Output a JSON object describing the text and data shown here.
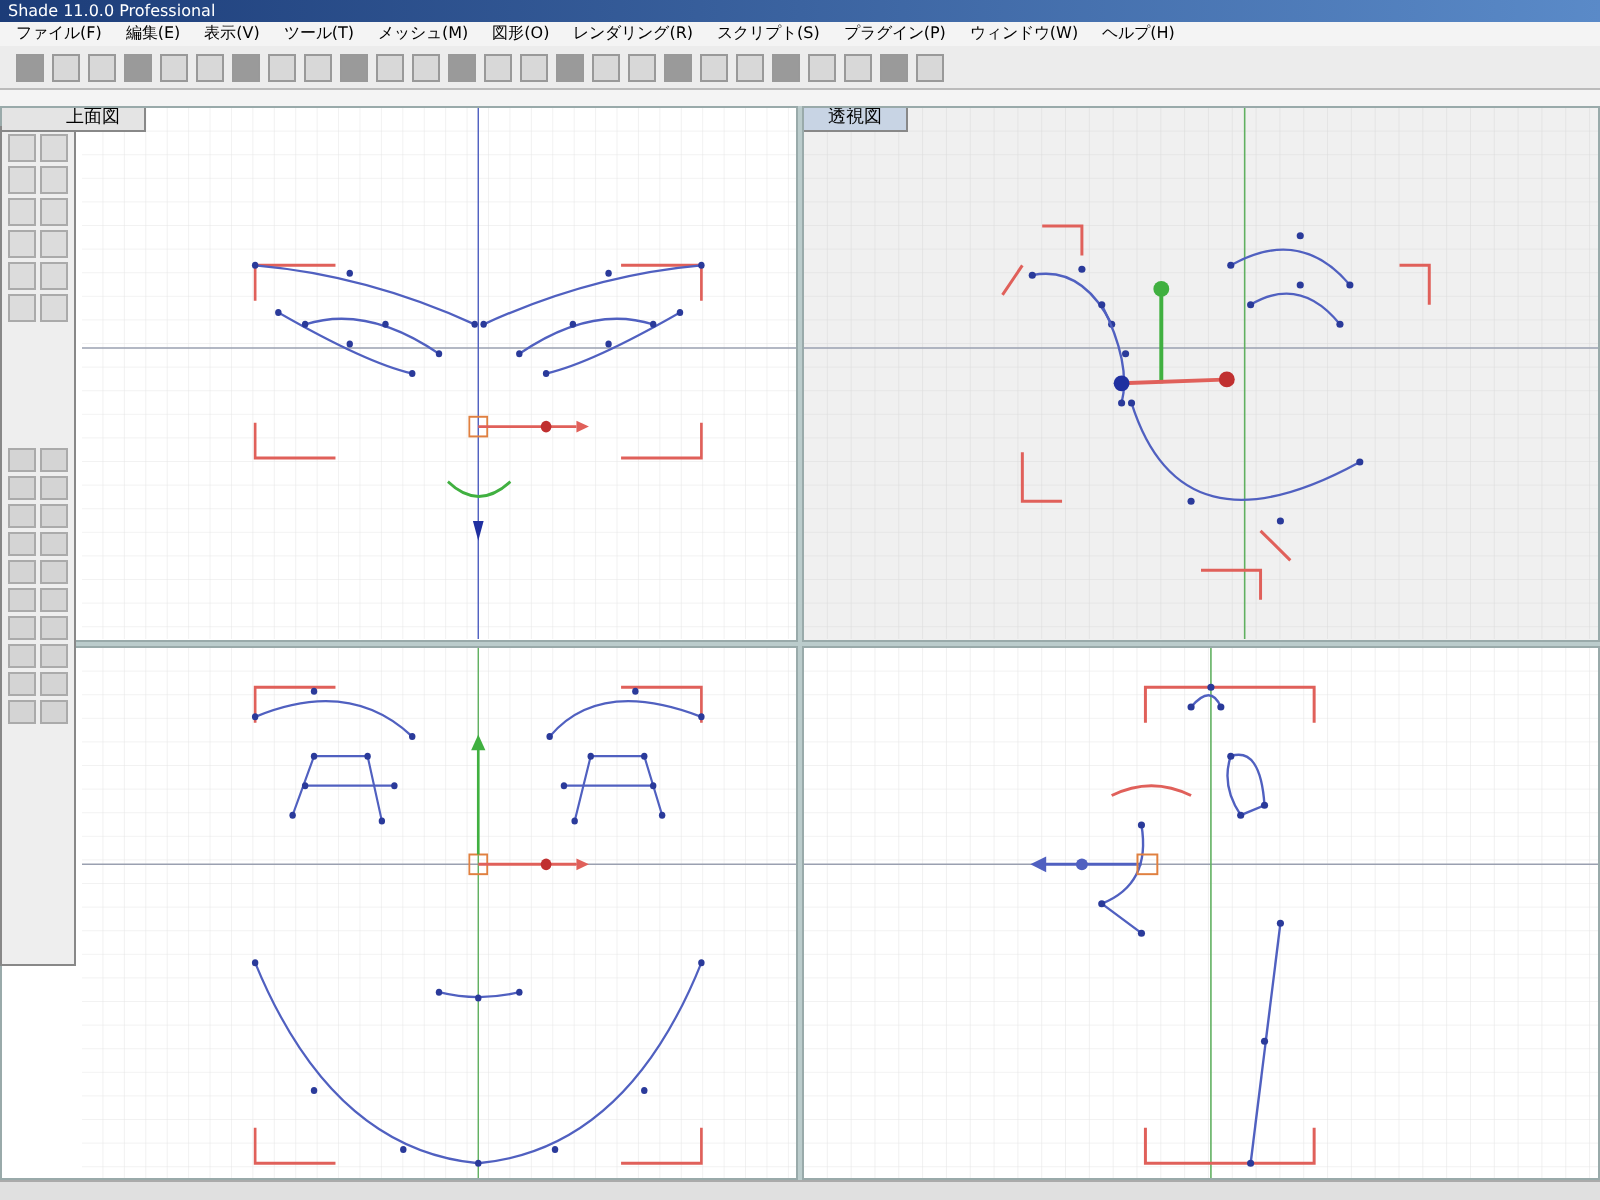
{
  "window": {
    "title": "Shade 11.0.0 Professional"
  },
  "menu": [
    "ファイル(F)",
    "編集(E)",
    "表示(V)",
    "ツール(T)",
    "メッシュ(M)",
    "図形(O)",
    "レンダリング(R)",
    "スクリプト(S)",
    "プラグイン(P)",
    "ウィンドウ(W)",
    "ヘルプ(H)"
  ],
  "viewports": [
    {
      "kind": "top",
      "title": "上面図"
    },
    {
      "kind": "perspective",
      "title": "透視図"
    },
    {
      "kind": "front"
    },
    {
      "kind": "side"
    }
  ]
}
